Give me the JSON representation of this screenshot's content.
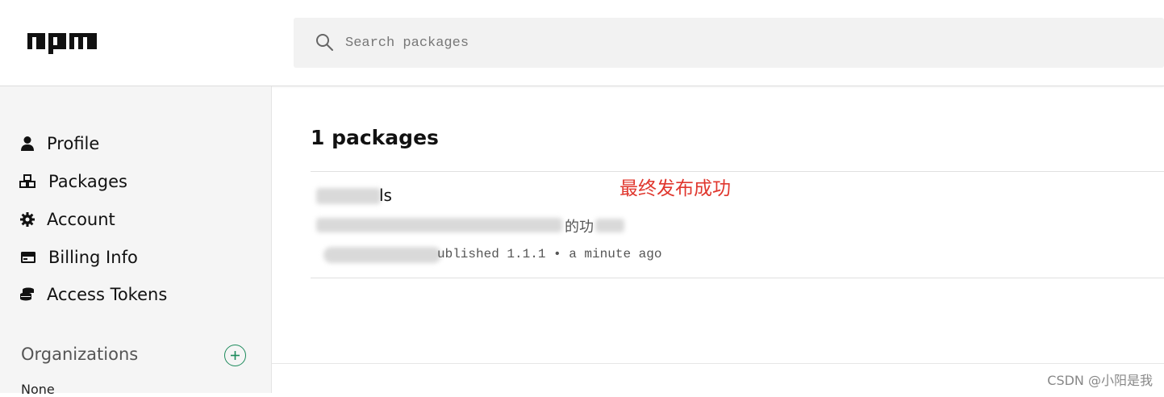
{
  "header": {
    "logo_text": "npm",
    "search_placeholder": "Search packages"
  },
  "sidebar": {
    "items": [
      {
        "label": "Profile",
        "icon": "user-icon"
      },
      {
        "label": "Packages",
        "icon": "cubes-icon"
      },
      {
        "label": "Account",
        "icon": "gear-icon"
      },
      {
        "label": "Billing Info",
        "icon": "credit-card-icon"
      },
      {
        "label": "Access Tokens",
        "icon": "coins-icon"
      }
    ],
    "organizations_label": "Organizations",
    "organizations_value": "None"
  },
  "main": {
    "title": "1 packages",
    "package": {
      "name_visible": "ls",
      "description_visible": "的功",
      "meta": "ublished 1.1.1 • a minute ago"
    },
    "annotation": "最终发布成功"
  },
  "watermark": "CSDN @小阳是我"
}
